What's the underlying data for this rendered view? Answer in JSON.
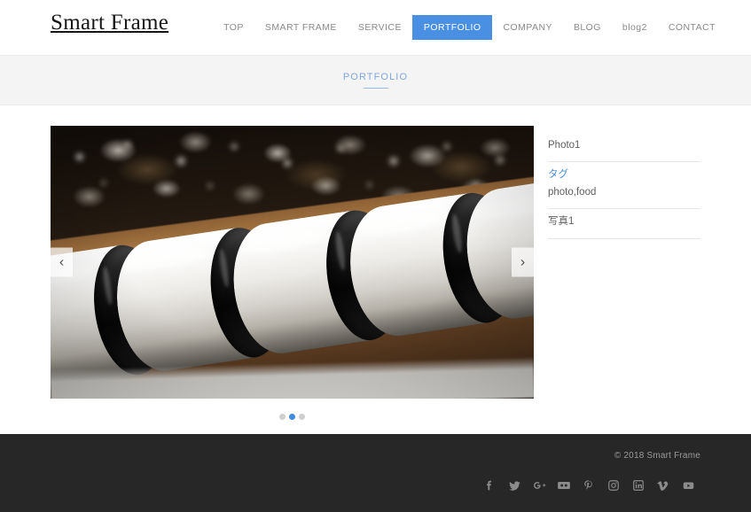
{
  "header": {
    "logo": "Smart Frame",
    "nav": [
      {
        "label": "TOP",
        "active": false
      },
      {
        "label": "SMART FRAME",
        "active": false
      },
      {
        "label": "SERVICE",
        "active": false
      },
      {
        "label": "PORTFOLIO",
        "active": true
      },
      {
        "label": "COMPANY",
        "active": false
      },
      {
        "label": "BLOG",
        "active": false
      },
      {
        "label": "blog2",
        "active": false
      },
      {
        "label": "CONTACT",
        "active": false
      }
    ]
  },
  "page": {
    "title": "PORTFOLIO"
  },
  "carousel": {
    "prev_label": "‹",
    "next_label": "›",
    "slide_alt": "wine-bottles-in-cellar-rack",
    "dots": [
      {
        "active": false
      },
      {
        "active": true
      },
      {
        "active": false
      }
    ]
  },
  "meta": {
    "photo_title": "Photo1",
    "tag_label": "タグ",
    "tag_value": "photo,food",
    "caption": "写真1"
  },
  "footer": {
    "copyright": "© 2018 Smart Frame",
    "social": [
      {
        "name": "facebook-icon",
        "glyph": "f"
      },
      {
        "name": "twitter-icon",
        "glyph": "t"
      },
      {
        "name": "google-plus-icon",
        "glyph": "g+"
      },
      {
        "name": "flickr-icon",
        "glyph": "flickr"
      },
      {
        "name": "pinterest-icon",
        "glyph": "p"
      },
      {
        "name": "instagram-icon",
        "glyph": "ig"
      },
      {
        "name": "linkedin-icon",
        "glyph": "in"
      },
      {
        "name": "vimeo-icon",
        "glyph": "v"
      },
      {
        "name": "youtube-icon",
        "glyph": "yt"
      }
    ]
  },
  "colors": {
    "accent": "#4a90e2",
    "title_blue": "#7fa8dd",
    "footer_bg": "#272727",
    "title_bar_bg": "#f4f4f4",
    "muted_text": "#8a8a8a"
  }
}
